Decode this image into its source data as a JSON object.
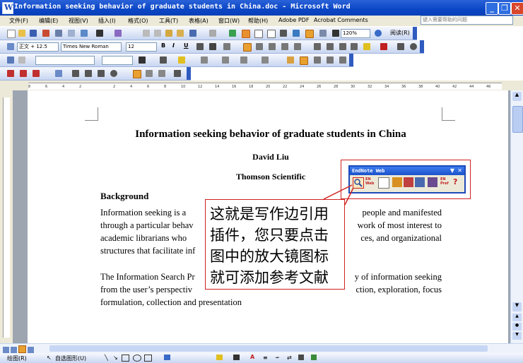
{
  "window": {
    "title": "Information seeking behavior of graduate students in China.doc - Microsoft Word"
  },
  "menu": [
    "文件(F)",
    "编辑(E)",
    "视图(V)",
    "插入(I)",
    "格式(O)",
    "工具(T)",
    "表格(A)",
    "窗口(W)",
    "帮助(H)",
    "Adobe PDF",
    "Acrobat Comments"
  ],
  "help_placeholder": "键入需要帮助的问题",
  "toolbar": {
    "zoom": "120%",
    "reading_label": "阅读(R)",
    "style": "正文 + 12.5",
    "font": "Times New Roman",
    "size": "12",
    "bold": "B",
    "italic": "I",
    "underline": "U"
  },
  "ruler_ticks": [
    "8",
    "6",
    "4",
    "2",
    "",
    "2",
    "4",
    "6",
    "8",
    "10",
    "12",
    "14",
    "16",
    "18",
    "20",
    "22",
    "24",
    "26",
    "28",
    "30",
    "32",
    "34",
    "36",
    "38",
    "40",
    "42",
    "44",
    "46"
  ],
  "document": {
    "title": "Information seeking behavior of graduate students in China",
    "author": "David Liu",
    "organization": "Thomson Scientific",
    "heading": "Background",
    "para1": [
      "Information seeking is a",
      "people and manifested",
      "through a particular behav",
      "work of most interest to",
      "academic librarians who",
      "ces, and organizational",
      "structures that facilitate inf"
    ],
    "para2": [
      "The Information Search Pr",
      "y of information seeking",
      "from the user’s perspectiv",
      "ction, exploration, focus",
      "formulation, collection and presentation"
    ]
  },
  "endnote_toolbar": {
    "title": "EndNote Web",
    "buttons": [
      "magnifier-icon",
      "en-web-icon",
      "list-icon",
      "edit-icon",
      "edit2-icon",
      "export-icon",
      "cite-icon",
      "en-pref-icon",
      "help-icon"
    ]
  },
  "callout": {
    "lines": [
      "这就是写作边引用",
      "插件，您只要点击",
      "图中的放大镜图标",
      "就可添加参考文献"
    ]
  },
  "drawing": {
    "draw_label": "绘图(R)",
    "autoshape_label": "自选图形(U)"
  },
  "colors": {
    "title_bar": "#0b46c6",
    "callout_border": "#d02020",
    "endnote_border": "#1e4ab8"
  }
}
